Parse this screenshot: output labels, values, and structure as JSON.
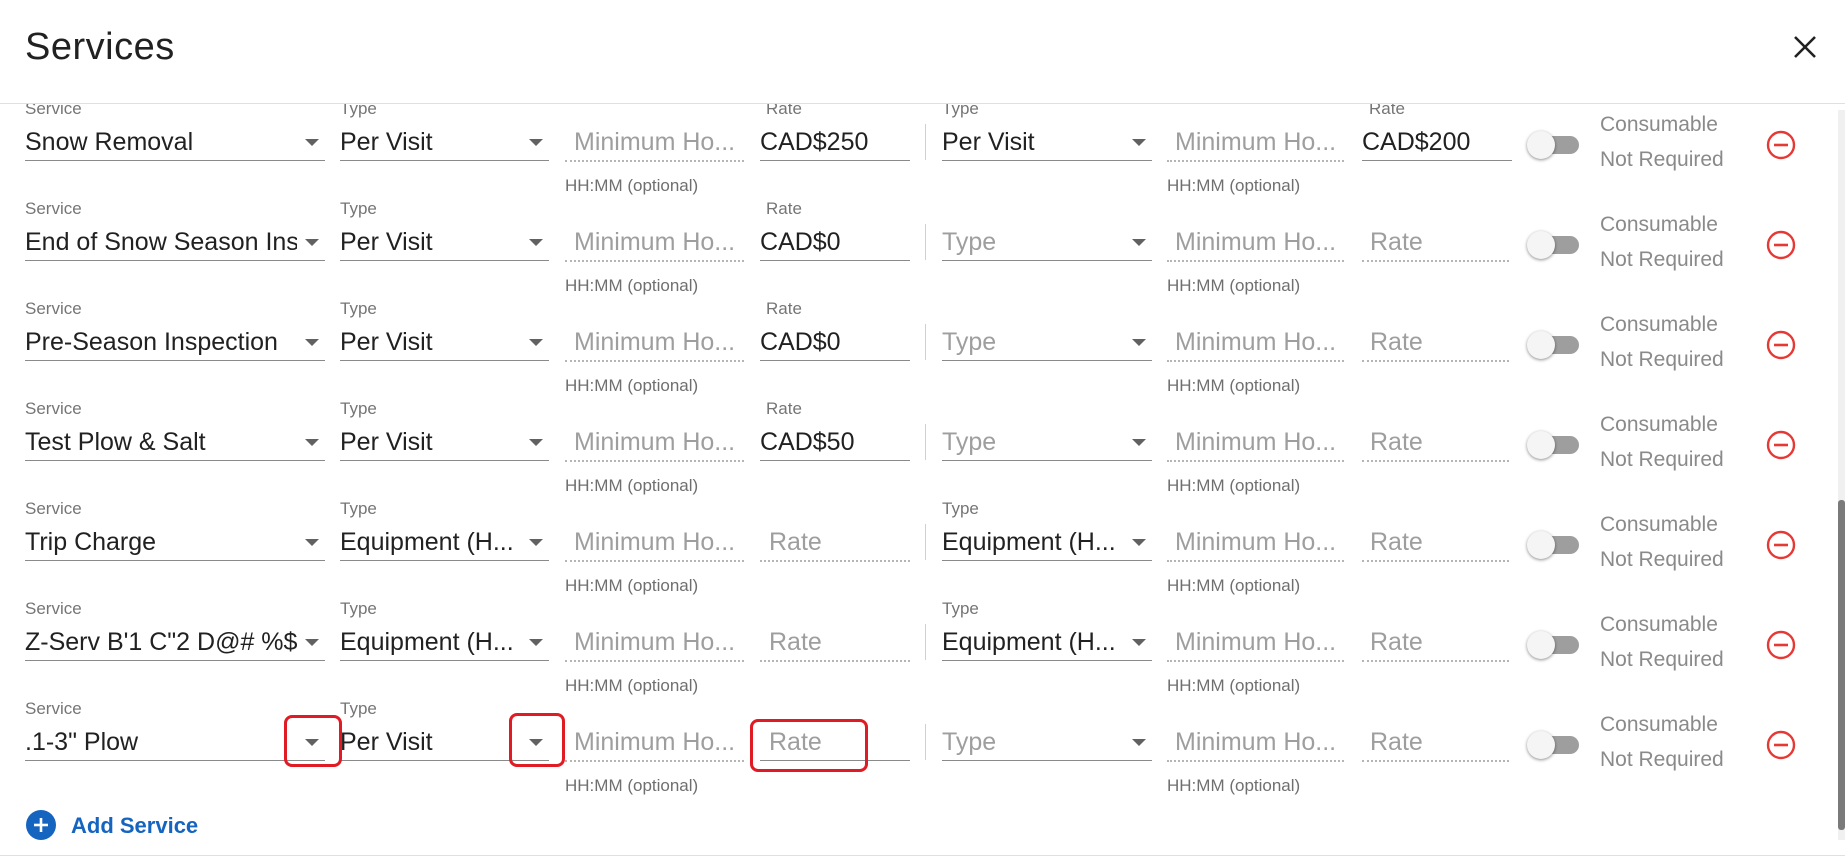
{
  "dialog": {
    "title": "Services"
  },
  "labels": {
    "service": "Service",
    "type": "Type",
    "rate": "Rate",
    "hint": "HH:MM (optional)",
    "min_hours_placeholder": "Minimum Ho...",
    "type_placeholder": "Type",
    "rate_placeholder": "Rate",
    "consumable": "Consumable",
    "not_required": "Not Required"
  },
  "rows": [
    {
      "service": "Snow Removal",
      "type1": "Per Visit",
      "rate1": "CAD$250",
      "type2": "Per Visit",
      "rate2": "CAD$200",
      "consumable": false
    },
    {
      "service": "End of Snow Season Insp",
      "type1": "Per Visit",
      "rate1": "CAD$0",
      "type2": "",
      "rate2": "",
      "consumable": false
    },
    {
      "service": "Pre-Season Inspection",
      "type1": "Per Visit",
      "rate1": "CAD$0",
      "type2": "",
      "rate2": "",
      "consumable": false
    },
    {
      "service": "Test Plow & Salt",
      "type1": "Per Visit",
      "rate1": "CAD$50",
      "type2": "",
      "rate2": "",
      "consumable": false
    },
    {
      "service": "Trip Charge",
      "type1": "Equipment (H...",
      "rate1": "",
      "type2": "Equipment (H...",
      "rate2": "",
      "consumable": false
    },
    {
      "service": "Z-Serv B'1 C\"2 D@# %$",
      "type1": "Equipment (H...",
      "rate1": "",
      "type2": "Equipment (H...",
      "rate2": "",
      "consumable": false
    },
    {
      "service": ".1-3\" Plow",
      "type1": "Per Visit",
      "rate1": "",
      "type2": "",
      "rate2": "",
      "consumable": false
    }
  ],
  "footer": {
    "add_service": "Add Service"
  },
  "colors": {
    "accent": "#1565c0",
    "remove": "#e53935",
    "highlight": "#e01b24"
  }
}
